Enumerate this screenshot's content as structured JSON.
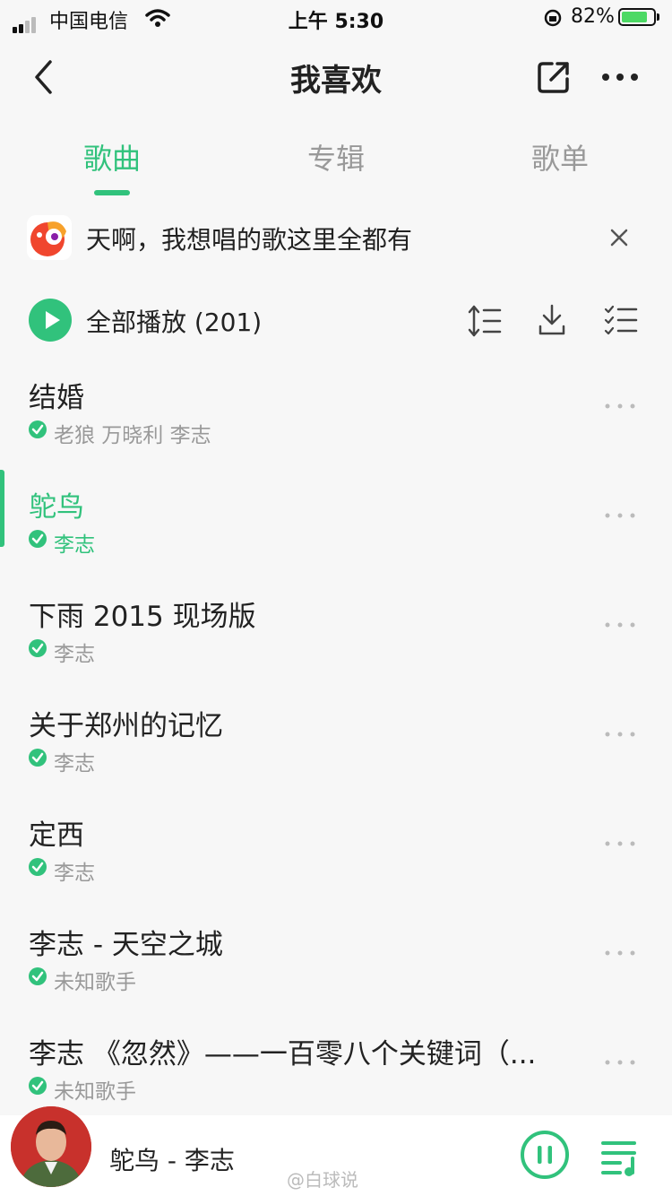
{
  "status_bar": {
    "carrier": "中国电信",
    "time": "上午 5:30",
    "battery": "82%",
    "battery_level": 0.82
  },
  "header": {
    "title": "我喜欢"
  },
  "tabs": [
    {
      "label": "歌曲",
      "active": true
    },
    {
      "label": "专辑",
      "active": false
    },
    {
      "label": "歌单",
      "active": false
    }
  ],
  "banner": {
    "text": "天啊，我想唱的歌这里全都有"
  },
  "play_all": {
    "label": "全部播放",
    "count": "(201)"
  },
  "songs": [
    {
      "title": "结婚",
      "artist": "老狼 万晓利 李志",
      "playing": false
    },
    {
      "title": "鸵鸟",
      "artist": "李志",
      "playing": true
    },
    {
      "title": "下雨 2015 现场版",
      "artist": "李志",
      "playing": false
    },
    {
      "title": "关于郑州的记忆",
      "artist": "李志",
      "playing": false
    },
    {
      "title": "定西",
      "artist": "李志",
      "playing": false
    },
    {
      "title": "李志 - 天空之城",
      "artist": "未知歌手",
      "playing": false
    },
    {
      "title": "李志 《忽然》——一百零八个关键词（...",
      "artist": "未知歌手",
      "playing": false
    }
  ],
  "player": {
    "now_playing": "鸵鸟 - 李志"
  },
  "watermark": "@白球说",
  "colors": {
    "accent": "#31c27c",
    "background": "#f7f7f7",
    "text": "#222222",
    "secondary": "#999999"
  },
  "icons": [
    "back-icon",
    "share-icon",
    "more-icon",
    "close-icon",
    "play-icon",
    "sort-icon",
    "download-icon",
    "multi-select-icon",
    "pause-icon",
    "playlist-icon",
    "wifi-icon",
    "orientation-lock-icon"
  ]
}
